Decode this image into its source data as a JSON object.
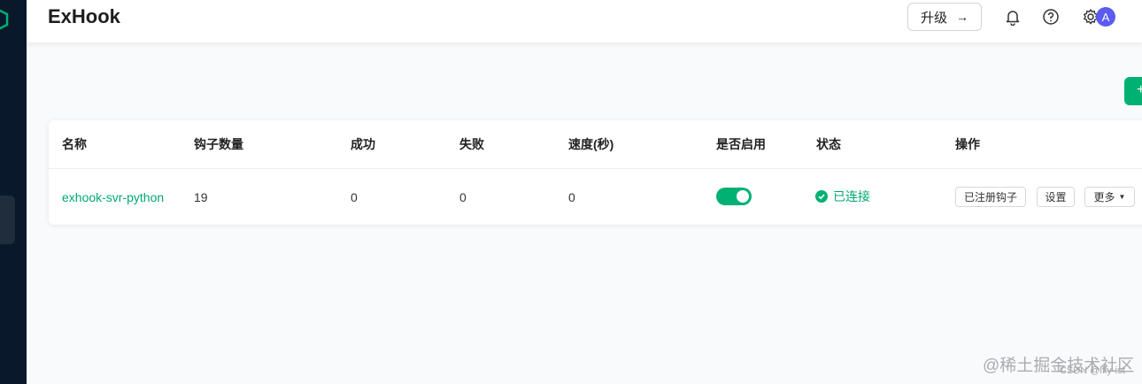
{
  "header": {
    "title": "ExHook",
    "upgrade_label": "升级",
    "avatar_letter": "A"
  },
  "toolbar": {
    "create_label": "+"
  },
  "table": {
    "columns": [
      "名称",
      "钩子数量",
      "成功",
      "失败",
      "速度(秒)",
      "是否启用",
      "状态",
      "操作"
    ],
    "rows": [
      {
        "name": "exhook-svr-python",
        "hooks": "19",
        "success": "0",
        "failed": "0",
        "speed": "0",
        "enabled": true,
        "status": "已连接",
        "actions": {
          "registered_hooks": "已注册钩子",
          "settings": "设置",
          "more": "更多"
        }
      }
    ]
  },
  "watermark": {
    "site": "@稀土掘金技术社区",
    "csdn": "CSDN @lfly-iot"
  },
  "colors": {
    "accent": "#00b173",
    "sidebar": "#09192b"
  }
}
